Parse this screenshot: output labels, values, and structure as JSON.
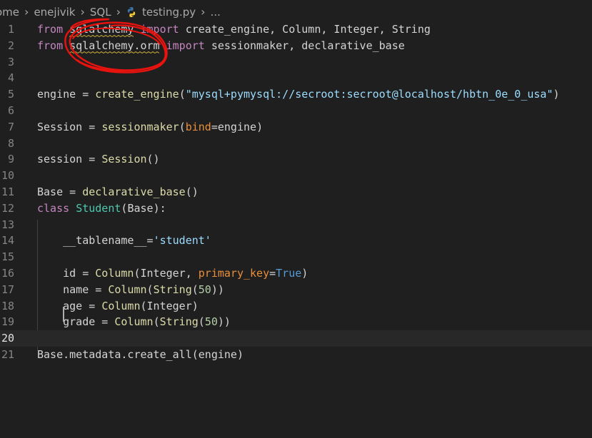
{
  "breadcrumb": {
    "items": [
      "ome",
      "enejivik",
      "SQL",
      "testing.py",
      "..."
    ]
  },
  "editor": {
    "lines": [
      {
        "num": "1",
        "parts": [
          [
            "kw",
            "from"
          ],
          [
            "op",
            " "
          ],
          [
            "mod",
            "sqlalchemy"
          ],
          [
            "op",
            " "
          ],
          [
            "kw",
            "import"
          ],
          [
            "op",
            " create_engine, Column, Integer, String"
          ]
        ]
      },
      {
        "num": "2",
        "parts": [
          [
            "kw",
            "from"
          ],
          [
            "op",
            " "
          ],
          [
            "mod",
            "sqlalchemy.orm"
          ],
          [
            "op",
            " "
          ],
          [
            "kw",
            "import"
          ],
          [
            "op",
            " sessionmaker, declarative_base"
          ]
        ]
      },
      {
        "num": "3",
        "parts": []
      },
      {
        "num": "4",
        "parts": []
      },
      {
        "num": "5",
        "parts": [
          [
            "var",
            "engine"
          ],
          [
            "op",
            " = "
          ],
          [
            "fn",
            "create_engine"
          ],
          [
            "punc",
            "("
          ],
          [
            "strurl",
            "\"mysql+pymysql://secroot:secroot@localhost/hbtn_0e_0_usa\""
          ],
          [
            "punc",
            ")"
          ]
        ]
      },
      {
        "num": "6",
        "parts": []
      },
      {
        "num": "7",
        "parts": [
          [
            "var",
            "Session"
          ],
          [
            "op",
            " = "
          ],
          [
            "fn",
            "sessionmaker"
          ],
          [
            "punc",
            "("
          ],
          [
            "param",
            "bind"
          ],
          [
            "op",
            "="
          ],
          [
            "var",
            "engine"
          ],
          [
            "punc",
            ")"
          ]
        ]
      },
      {
        "num": "8",
        "parts": []
      },
      {
        "num": "9",
        "parts": [
          [
            "var",
            "session"
          ],
          [
            "op",
            " = "
          ],
          [
            "fn",
            "Session"
          ],
          [
            "punc",
            "()"
          ]
        ]
      },
      {
        "num": "10",
        "parts": []
      },
      {
        "num": "11",
        "parts": [
          [
            "var",
            "Base"
          ],
          [
            "op",
            " = "
          ],
          [
            "fn",
            "declarative_base"
          ],
          [
            "punc",
            "()"
          ]
        ]
      },
      {
        "num": "12",
        "parts": [
          [
            "kw",
            "class"
          ],
          [
            "op",
            " "
          ],
          [
            "cls",
            "Student"
          ],
          [
            "punc",
            "("
          ],
          [
            "var",
            "Base"
          ],
          [
            "punc",
            "):"
          ]
        ]
      },
      {
        "num": "13",
        "parts": []
      },
      {
        "num": "14",
        "parts": [
          [
            "op",
            "    "
          ],
          [
            "var",
            "__tablename__"
          ],
          [
            "op",
            "="
          ],
          [
            "strurl",
            "'student'"
          ]
        ]
      },
      {
        "num": "15",
        "parts": []
      },
      {
        "num": "16",
        "parts": [
          [
            "op",
            "    "
          ],
          [
            "var",
            "id"
          ],
          [
            "op",
            " = "
          ],
          [
            "fn",
            "Column"
          ],
          [
            "punc",
            "("
          ],
          [
            "var",
            "Integer"
          ],
          [
            "punc",
            ", "
          ],
          [
            "param",
            "primary_key"
          ],
          [
            "op",
            "="
          ],
          [
            "keywd",
            "True"
          ],
          [
            "punc",
            ")"
          ]
        ]
      },
      {
        "num": "17",
        "parts": [
          [
            "op",
            "    "
          ],
          [
            "var",
            "name"
          ],
          [
            "op",
            " = "
          ],
          [
            "fn",
            "Column"
          ],
          [
            "punc",
            "("
          ],
          [
            "fn",
            "String"
          ],
          [
            "punc",
            "("
          ],
          [
            "num",
            "50"
          ],
          [
            "punc",
            "))"
          ]
        ]
      },
      {
        "num": "18",
        "parts": [
          [
            "op",
            "    "
          ],
          [
            "var",
            "age"
          ],
          [
            "op",
            " = "
          ],
          [
            "fn",
            "Column"
          ],
          [
            "punc",
            "("
          ],
          [
            "var",
            "Integer"
          ],
          [
            "punc",
            ")"
          ]
        ]
      },
      {
        "num": "19",
        "parts": [
          [
            "op",
            "    "
          ],
          [
            "var",
            "grade"
          ],
          [
            "op",
            " = "
          ],
          [
            "fn",
            "Column"
          ],
          [
            "punc",
            "("
          ],
          [
            "fn",
            "String"
          ],
          [
            "punc",
            "("
          ],
          [
            "num",
            "50"
          ],
          [
            "punc",
            "))"
          ]
        ]
      },
      {
        "num": "20",
        "parts": [],
        "current": true
      },
      {
        "num": "21",
        "parts": [
          [
            "var",
            "Base.metadata.create_all"
          ],
          [
            "punc",
            "("
          ],
          [
            "var",
            "engine"
          ],
          [
            "punc",
            ")"
          ]
        ]
      }
    ]
  },
  "icons": {
    "python": "python-file-icon"
  },
  "colors": {
    "background": "#1f1f1f",
    "current_line": "#282828",
    "annotation": "#e8130f",
    "squiggle": "#c9a83b"
  }
}
